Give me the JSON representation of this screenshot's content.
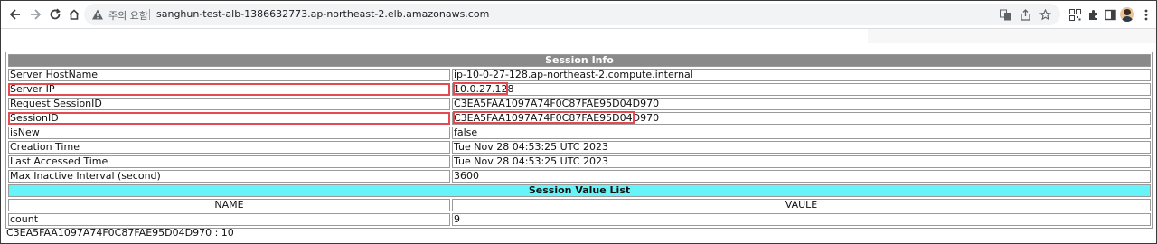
{
  "browser": {
    "security_warning": "주의 요함",
    "url": "sanghun-test-alb-1386632773.ap-northeast-2.elb.amazonaws.com"
  },
  "session_info": {
    "title": "Session Info",
    "rows": [
      {
        "label": "Server HostName",
        "value": "ip-10-0-27-128.ap-northeast-2.compute.internal"
      },
      {
        "label": "Server IP",
        "value": "10.0.27.128"
      },
      {
        "label": "Request SessionID",
        "value": "C3EA5FAA1097A74F0C87FAE95D04D970"
      },
      {
        "label": "SessionID",
        "value": "C3EA5FAA1097A74F0C87FAE95D04D970"
      },
      {
        "label": "isNew",
        "value": "false"
      },
      {
        "label": "Creation Time",
        "value": "Tue Nov 28 04:53:25 UTC 2023"
      },
      {
        "label": "Last Accessed Time",
        "value": "Tue Nov 28 04:53:25 UTC 2023"
      },
      {
        "label": "Max Inactive Interval (second)",
        "value": "3600"
      }
    ]
  },
  "session_value_list": {
    "title": "Session Value List",
    "columns": [
      "NAME",
      "VAULE"
    ],
    "rows": [
      {
        "name": "count",
        "value": "9"
      }
    ]
  },
  "footer_text": "C3EA5FAA1097A74F0C87FAE95D04D970 : 10",
  "colors": {
    "info_header_bg": "#8a8a8a",
    "list_header_bg": "#66f4f9",
    "highlight": "#e34a52"
  }
}
